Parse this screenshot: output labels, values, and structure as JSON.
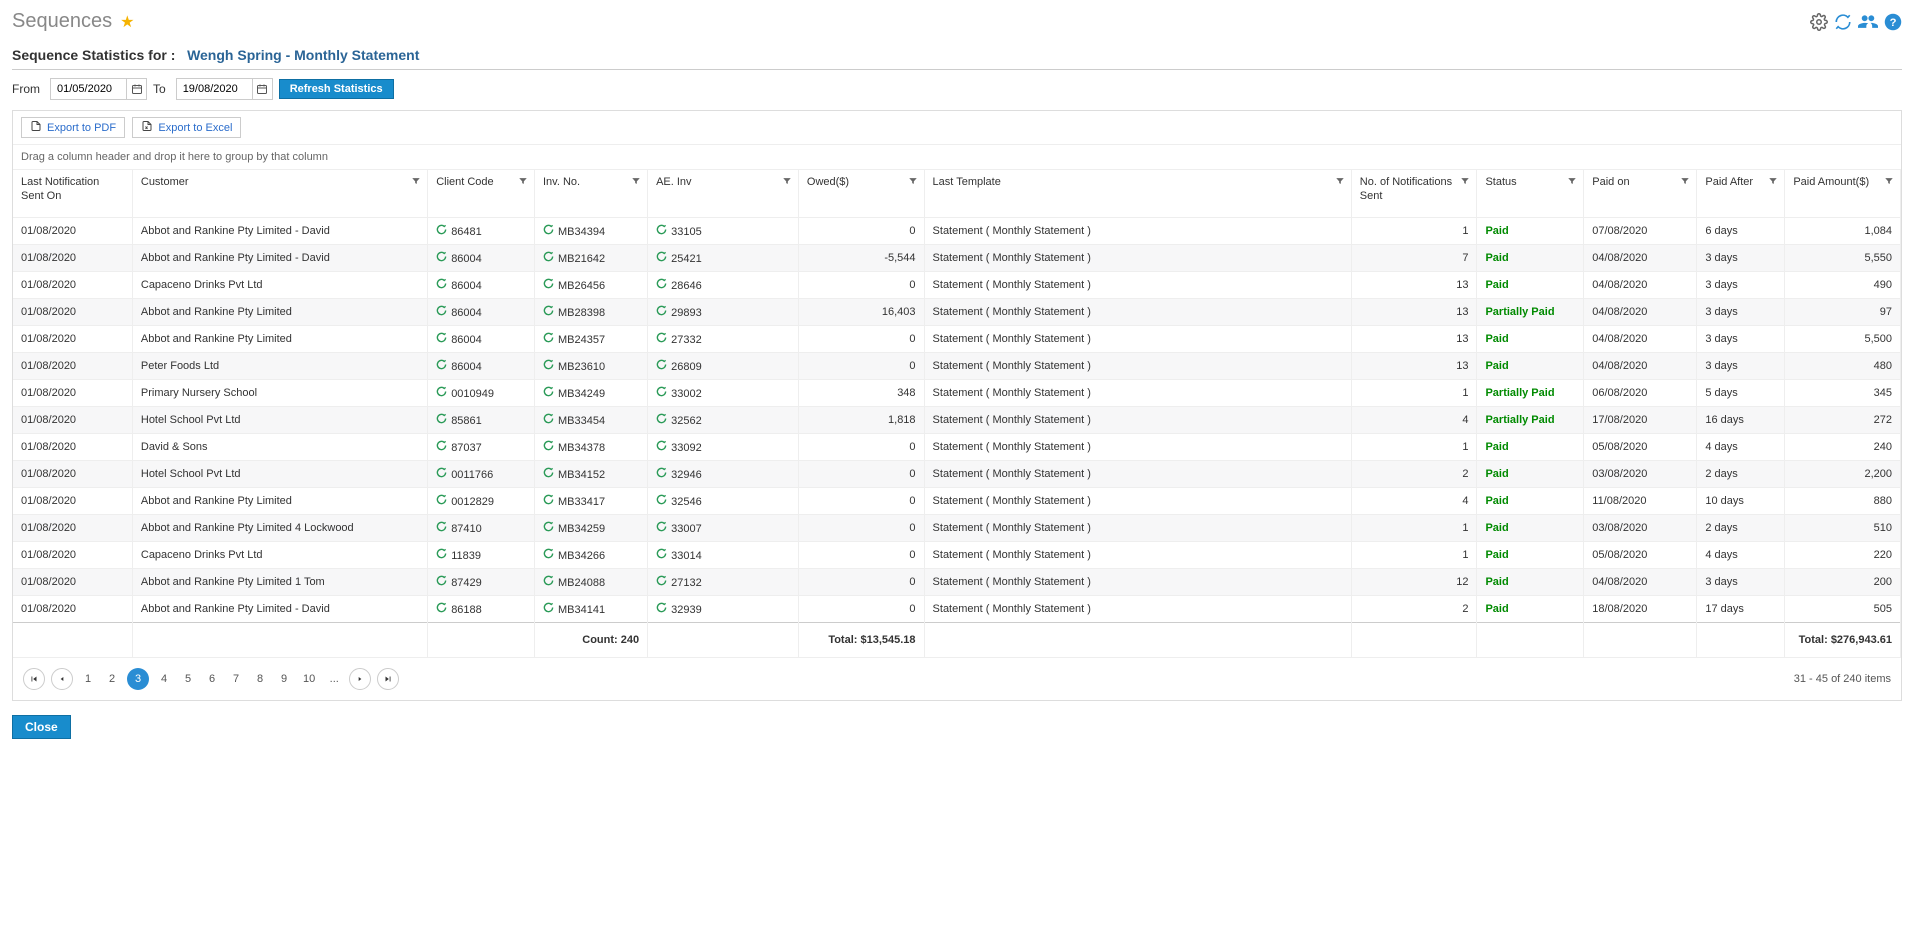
{
  "pageTitle": "Sequences",
  "statsTitlePrefix": "Sequence Statistics for :",
  "sequenceName": "Wengh Spring - Monthly Statement",
  "filter": {
    "fromLabel": "From",
    "fromValue": "01/05/2020",
    "toLabel": "To",
    "toValue": "19/08/2020",
    "refreshLabel": "Refresh Statistics"
  },
  "exportPdfLabel": "Export to PDF",
  "exportExcelLabel": "Export to Excel",
  "groupHint": "Drag a column header and drop it here to group by that column",
  "columns": [
    "Last Notification Sent On",
    "Customer",
    "Client Code",
    "Inv. No.",
    "AE. Inv",
    "Owed($)",
    "Last Template",
    "No. of Notifications Sent",
    "Status",
    "Paid on",
    "Paid After",
    "Paid Amount($)"
  ],
  "rows": [
    {
      "sent": "01/08/2020",
      "cust": "Abbot and Rankine Pty Limited - David",
      "code": "86481",
      "inv": "MB34394",
      "ae": "33105",
      "owed": "0",
      "tpl": "Statement ( Monthly Statement )",
      "nsent": "1",
      "status": "Paid",
      "paidon": "07/08/2020",
      "after": "6 days",
      "amount": "1,084"
    },
    {
      "sent": "01/08/2020",
      "cust": "Abbot and Rankine Pty Limited - David",
      "code": "86004",
      "inv": "MB21642",
      "ae": "25421",
      "owed": "-5,544",
      "tpl": "Statement ( Monthly Statement )",
      "nsent": "7",
      "status": "Paid",
      "paidon": "04/08/2020",
      "after": "3 days",
      "amount": "5,550"
    },
    {
      "sent": "01/08/2020",
      "cust": "Capaceno Drinks Pvt Ltd",
      "code": "86004",
      "inv": "MB26456",
      "ae": "28646",
      "owed": "0",
      "tpl": "Statement ( Monthly Statement )",
      "nsent": "13",
      "status": "Paid",
      "paidon": "04/08/2020",
      "after": "3 days",
      "amount": "490"
    },
    {
      "sent": "01/08/2020",
      "cust": "Abbot and Rankine Pty Limited",
      "code": "86004",
      "inv": "MB28398",
      "ae": "29893",
      "owed": "16,403",
      "tpl": "Statement ( Monthly Statement )",
      "nsent": "13",
      "status": "Partially Paid",
      "paidon": "04/08/2020",
      "after": "3 days",
      "amount": "97"
    },
    {
      "sent": "01/08/2020",
      "cust": "Abbot and Rankine Pty Limited",
      "code": "86004",
      "inv": "MB24357",
      "ae": "27332",
      "owed": "0",
      "tpl": "Statement ( Monthly Statement )",
      "nsent": "13",
      "status": "Paid",
      "paidon": "04/08/2020",
      "after": "3 days",
      "amount": "5,500"
    },
    {
      "sent": "01/08/2020",
      "cust": "Peter Foods Ltd",
      "code": "86004",
      "inv": "MB23610",
      "ae": "26809",
      "owed": "0",
      "tpl": "Statement ( Monthly Statement )",
      "nsent": "13",
      "status": "Paid",
      "paidon": "04/08/2020",
      "after": "3 days",
      "amount": "480"
    },
    {
      "sent": "01/08/2020",
      "cust": "Primary Nursery School",
      "code": "0010949",
      "inv": "MB34249",
      "ae": "33002",
      "owed": "348",
      "tpl": "Statement ( Monthly Statement )",
      "nsent": "1",
      "status": "Partially Paid",
      "paidon": "06/08/2020",
      "after": "5 days",
      "amount": "345"
    },
    {
      "sent": "01/08/2020",
      "cust": "Hotel School Pvt Ltd",
      "code": "85861",
      "inv": "MB33454",
      "ae": "32562",
      "owed": "1,818",
      "tpl": "Statement ( Monthly Statement )",
      "nsent": "4",
      "status": "Partially Paid",
      "paidon": "17/08/2020",
      "after": "16 days",
      "amount": "272"
    },
    {
      "sent": "01/08/2020",
      "cust": "David & Sons",
      "code": "87037",
      "inv": "MB34378",
      "ae": "33092",
      "owed": "0",
      "tpl": "Statement ( Monthly Statement )",
      "nsent": "1",
      "status": "Paid",
      "paidon": "05/08/2020",
      "after": "4 days",
      "amount": "240"
    },
    {
      "sent": "01/08/2020",
      "cust": "Hotel School Pvt Ltd",
      "code": "0011766",
      "inv": "MB34152",
      "ae": "32946",
      "owed": "0",
      "tpl": "Statement ( Monthly Statement )",
      "nsent": "2",
      "status": "Paid",
      "paidon": "03/08/2020",
      "after": "2 days",
      "amount": "2,200"
    },
    {
      "sent": "01/08/2020",
      "cust": "Abbot and Rankine Pty Limited",
      "code": "0012829",
      "inv": "MB33417",
      "ae": "32546",
      "owed": "0",
      "tpl": "Statement ( Monthly Statement )",
      "nsent": "4",
      "status": "Paid",
      "paidon": "11/08/2020",
      "after": "10 days",
      "amount": "880"
    },
    {
      "sent": "01/08/2020",
      "cust": "Abbot and Rankine Pty Limited 4 Lockwood",
      "code": "87410",
      "inv": "MB34259",
      "ae": "33007",
      "owed": "0",
      "tpl": "Statement ( Monthly Statement )",
      "nsent": "1",
      "status": "Paid",
      "paidon": "03/08/2020",
      "after": "2 days",
      "amount": "510"
    },
    {
      "sent": "01/08/2020",
      "cust": "Capaceno Drinks Pvt Ltd",
      "code": "11839",
      "inv": "MB34266",
      "ae": "33014",
      "owed": "0",
      "tpl": "Statement ( Monthly Statement )",
      "nsent": "1",
      "status": "Paid",
      "paidon": "05/08/2020",
      "after": "4 days",
      "amount": "220"
    },
    {
      "sent": "01/08/2020",
      "cust": "Abbot and Rankine Pty Limited 1 Tom",
      "code": "87429",
      "inv": "MB24088",
      "ae": "27132",
      "owed": "0",
      "tpl": "Statement ( Monthly Statement )",
      "nsent": "12",
      "status": "Paid",
      "paidon": "04/08/2020",
      "after": "3 days",
      "amount": "200"
    },
    {
      "sent": "01/08/2020",
      "cust": "Abbot and Rankine Pty Limited - David",
      "code": "86188",
      "inv": "MB34141",
      "ae": "32939",
      "owed": "0",
      "tpl": "Statement ( Monthly Statement )",
      "nsent": "2",
      "status": "Paid",
      "paidon": "18/08/2020",
      "after": "17 days",
      "amount": "505"
    }
  ],
  "footer": {
    "countLabel": "Count: 240",
    "owedTotal": "Total: $13,545.18",
    "paidTotal": "Total: $276,943.61"
  },
  "pager": {
    "pages": [
      "1",
      "2",
      "3",
      "4",
      "5",
      "6",
      "7",
      "8",
      "9",
      "10",
      "..."
    ],
    "current": "3",
    "summary": "31 - 45 of 240 items"
  },
  "closeLabel": "Close"
}
